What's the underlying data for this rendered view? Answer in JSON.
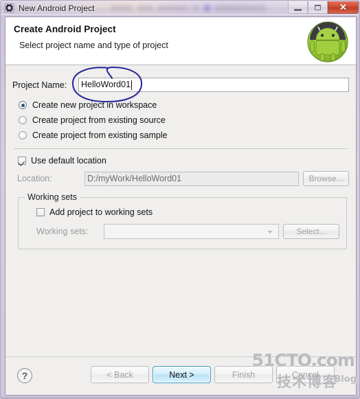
{
  "window": {
    "title": "New Android Project",
    "icon": "gear-icon",
    "controls": {
      "minimize": "Minimize",
      "maximize": "Maximize",
      "close": "✕"
    }
  },
  "wizard": {
    "title": "Create Android Project",
    "subtitle": "Select project name and type of project",
    "logo": "android-robot-logo"
  },
  "form": {
    "project_name_label": "Project Name:",
    "project_name_value": "HelloWord01",
    "project_name_placeholder": "",
    "options": [
      {
        "label": "Create new project in workspace",
        "selected": true
      },
      {
        "label": "Create project from existing source",
        "selected": false
      },
      {
        "label": "Create project from existing sample",
        "selected": false
      }
    ],
    "use_default_location_label": "Use default location",
    "use_default_location_checked": true,
    "location_label": "Location:",
    "location_value": "D:/myWork/HelloWord01",
    "browse_label": "Browse...",
    "working_sets": {
      "legend": "Working sets",
      "add_project_label": "Add project to working sets",
      "add_project_checked": false,
      "working_sets_label": "Working sets:",
      "working_sets_value": "",
      "select_label": "Select..."
    }
  },
  "footer": {
    "help": "?",
    "back_label": "< Back",
    "next_label": "Next >",
    "finish_label": "Finish",
    "cancel_label": "Cancel"
  },
  "annotation": {
    "type": "hand-drawn-ellipse",
    "color": "#2a2a9c",
    "target": "project-name-input"
  },
  "watermark": {
    "line1": "51CTO.com",
    "line2": "技术博客",
    "line3": "Blog",
    "color": "#a9a7ac"
  }
}
